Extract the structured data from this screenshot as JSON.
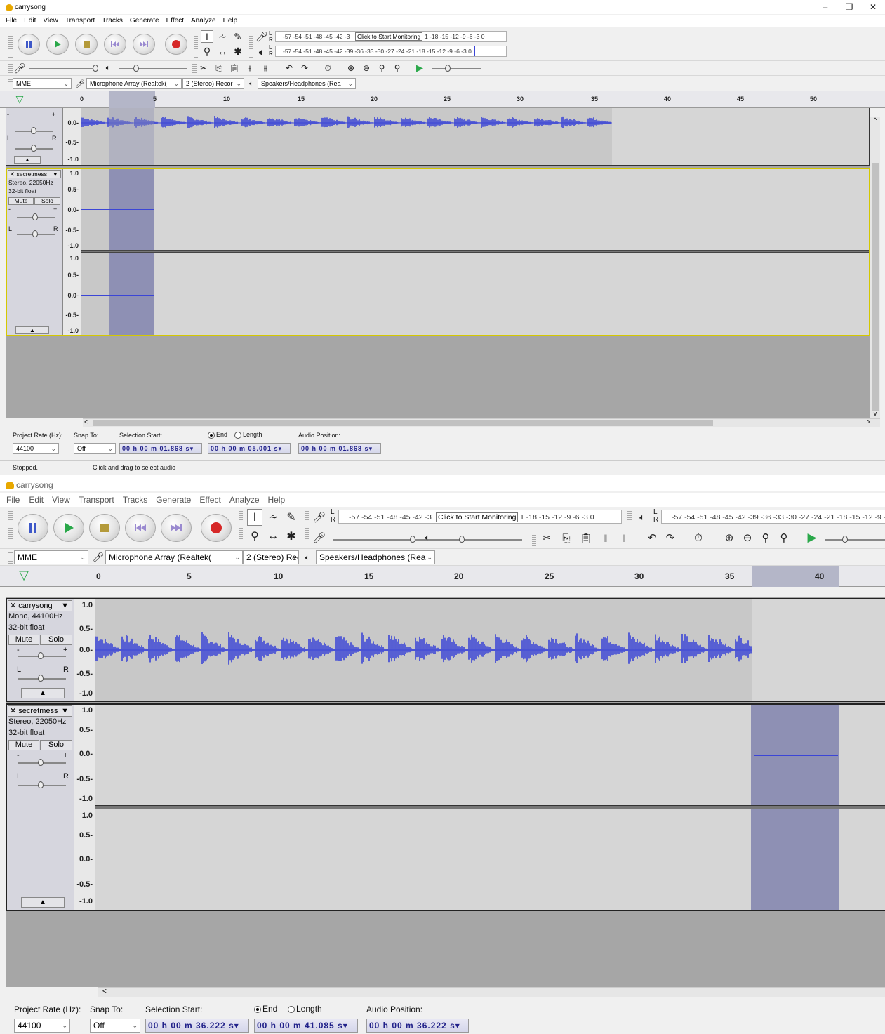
{
  "app": {
    "title": "carrysong"
  },
  "window_controls": {
    "minimize": "–",
    "restore": "❐",
    "close": "✕"
  },
  "menu": [
    "File",
    "Edit",
    "View",
    "Transport",
    "Tracks",
    "Generate",
    "Effect",
    "Analyze",
    "Help"
  ],
  "meters": {
    "record": "-57 -54 -51 -48 -45 -42 -3",
    "record_tip": "Click to Start Monitoring",
    "record_tail": "1 -18 -15 -12 -9 -6 -3 0",
    "play": "-57 -54 -51 -48 -45 -42 -39 -36 -33 -30 -27 -24 -21 -18 -15 -12 -9 -6 -3 0",
    "l": "L",
    "r": "R"
  },
  "device": {
    "host": "MME",
    "mic": "Microphone Array (Realtek(",
    "channels": "2 (Stereo) Recor",
    "speakers": "Speakers/Headphones (Rea"
  },
  "ruler1": {
    "ticks": [
      "0",
      "5",
      "10",
      "15",
      "20",
      "25",
      "30",
      "35",
      "40",
      "45",
      "50"
    ]
  },
  "ruler2": {
    "ticks": [
      "0",
      "5",
      "10",
      "15",
      "20",
      "25",
      "30",
      "35",
      "40"
    ]
  },
  "tracks": {
    "carrysong": {
      "name": "carrysong",
      "info1": "Mono, 44100Hz",
      "info2": "32-bit float"
    },
    "secretmess": {
      "name": "secretmess",
      "info1": "Stereo, 22050Hz",
      "info2": "32-bit float"
    },
    "mute": "Mute",
    "solo": "Solo",
    "close_x": "✕",
    "menu_arrow": "▼",
    "collapse": "▲",
    "scale": [
      "1.0",
      "0.5-",
      "0.0-",
      "-0.5-",
      "-1.0"
    ],
    "gain_minus": "-",
    "gain_plus": "+",
    "pan_l": "L",
    "pan_r": "R"
  },
  "selection1": {
    "project_rate_label": "Project Rate (Hz):",
    "project_rate": "44100",
    "snap_label": "Snap To:",
    "snap": "Off",
    "sel_start_label": "Selection Start:",
    "end_label": "End",
    "length_label": "Length",
    "audio_pos_label": "Audio Position:",
    "sel_start": "00 h 00 m 01.868 s",
    "sel_end": "00 h 00 m 05.001 s",
    "audio_pos": "00 h 00 m 01.868 s"
  },
  "selection2": {
    "project_rate_label": "Project Rate (Hz):",
    "project_rate": "44100",
    "snap_label": "Snap To:",
    "snap": "Off",
    "sel_start_label": "Selection Start:",
    "end_label": "End",
    "length_label": "Length",
    "audio_pos_label": "Audio Position:",
    "sel_start": "00 h 00 m 36.222 s",
    "sel_end": "00 h 00 m 41.085 s",
    "audio_pos": "00 h 00 m 36.222 s"
  },
  "status": {
    "state": "Stopped.",
    "hint": "Click and drag to select audio"
  },
  "scroll": {
    "left": "<",
    "right": ">",
    "up": "^",
    "down": "v"
  },
  "colors": {
    "wave": "#3b45d6",
    "selection": "#8e90b4",
    "track_focus": "#d4c800"
  }
}
